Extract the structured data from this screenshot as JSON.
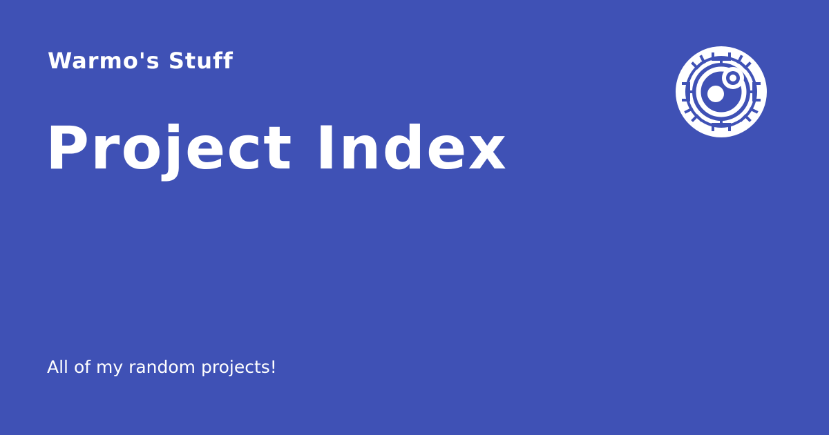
{
  "card": {
    "site_name": "Warmo's Stuff",
    "title": "Project Index",
    "description": "All of my random projects!",
    "logo_icon": "warmo-emblem-icon"
  },
  "colors": {
    "background": "#3f51b5",
    "text": "#ffffff"
  }
}
